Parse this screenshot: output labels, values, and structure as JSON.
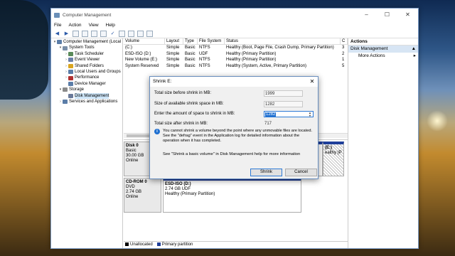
{
  "window": {
    "title": "Computer Management",
    "controls": [
      "–",
      "☐",
      "✕"
    ]
  },
  "menu": [
    "File",
    "Action",
    "View",
    "Help"
  ],
  "tree": [
    {
      "label": "Computer Management (Local",
      "level": 0,
      "arrow": "▾",
      "color": "#5b7da8"
    },
    {
      "label": "System Tools",
      "level": 1,
      "arrow": "▾",
      "color": "#7a8fa8"
    },
    {
      "label": "Task Scheduler",
      "level": 2,
      "arrow": "›",
      "color": "#5a8a5a"
    },
    {
      "label": "Event Viewer",
      "level": 2,
      "arrow": "›",
      "color": "#6a7fa8"
    },
    {
      "label": "Shared Folders",
      "level": 2,
      "arrow": "›",
      "color": "#d9a520"
    },
    {
      "label": "Local Users and Groups",
      "level": 2,
      "arrow": "›",
      "color": "#5b7da8"
    },
    {
      "label": "Performance",
      "level": 2,
      "arrow": "›",
      "color": "#b03030"
    },
    {
      "label": "Device Manager",
      "level": 2,
      "arrow": "",
      "color": "#5b7da8"
    },
    {
      "label": "Storage",
      "level": 1,
      "arrow": "▾",
      "color": "#8a8a8a"
    },
    {
      "label": "Disk Management",
      "level": 2,
      "arrow": "",
      "color": "#6a7a9a",
      "selected": true
    },
    {
      "label": "Services and Applications",
      "level": 1,
      "arrow": "›",
      "color": "#5b7da8"
    }
  ],
  "volumes": {
    "headers": [
      "Volume",
      "Layout",
      "Type",
      "File System",
      "Status",
      "C"
    ],
    "rows": [
      [
        "(C:)",
        "Simple",
        "Basic",
        "NTFS",
        "Healthy (Boot, Page File, Crash Dump, Primary Partition)",
        "3"
      ],
      [
        "ESD-ISO (D:)",
        "Simple",
        "Basic",
        "UDF",
        "Healthy (Primary Partition)",
        "2"
      ],
      [
        "New Volume (E:)",
        "Simple",
        "Basic",
        "NTFS",
        "Healthy (Primary Partition)",
        "1"
      ],
      [
        "System Reserved",
        "Simple",
        "Basic",
        "NTFS",
        "Healthy (System, Active, Primary Partition)",
        "5"
      ]
    ]
  },
  "disks": [
    {
      "name": "Disk 0",
      "type": "Basic",
      "size": "30.00 GB",
      "status": "Online",
      "parts": [
        {
          "label": "",
          "info": "",
          "hatch": false
        },
        {
          "label": "(E:)",
          "info": "ealthy (P",
          "hatch": true
        }
      ]
    },
    {
      "name": "CD-ROM 0",
      "type": "DVD",
      "size": "2.74 GB",
      "status": "Online",
      "parts": [
        {
          "label": "ESD-ISO  (D:)",
          "info": "2.74 GB UDF",
          "status": "Healthy (Primary Partition)",
          "hatch": false
        }
      ]
    }
  ],
  "legend": [
    {
      "label": "Unallocated",
      "color": "#000000"
    },
    {
      "label": "Primary partition",
      "color": "#1f3f9a"
    }
  ],
  "actions": {
    "header": "Actions",
    "section": "Disk Management",
    "item": "More Actions"
  },
  "dialog": {
    "title": "Shrink E:",
    "rows": [
      {
        "label": "Total size before shrink in MB:",
        "value": "1999"
      },
      {
        "label": "Size of available shrink space in MB:",
        "value": "1282"
      },
      {
        "label": "Enter the amount of space to shrink in MB:",
        "value": "1282"
      },
      {
        "label": "Total size after shrink in MB:",
        "value": "717"
      }
    ],
    "info": "You cannot shrink a volume beyond the point where any unmovable files are located. See the \"defrag\" event in the Application log for detailed information about the operation when it has completed.",
    "help": "See \"Shrink a basic volume\" in Disk Management help for more information",
    "shrink": "Shrink",
    "cancel": "Cancel"
  }
}
